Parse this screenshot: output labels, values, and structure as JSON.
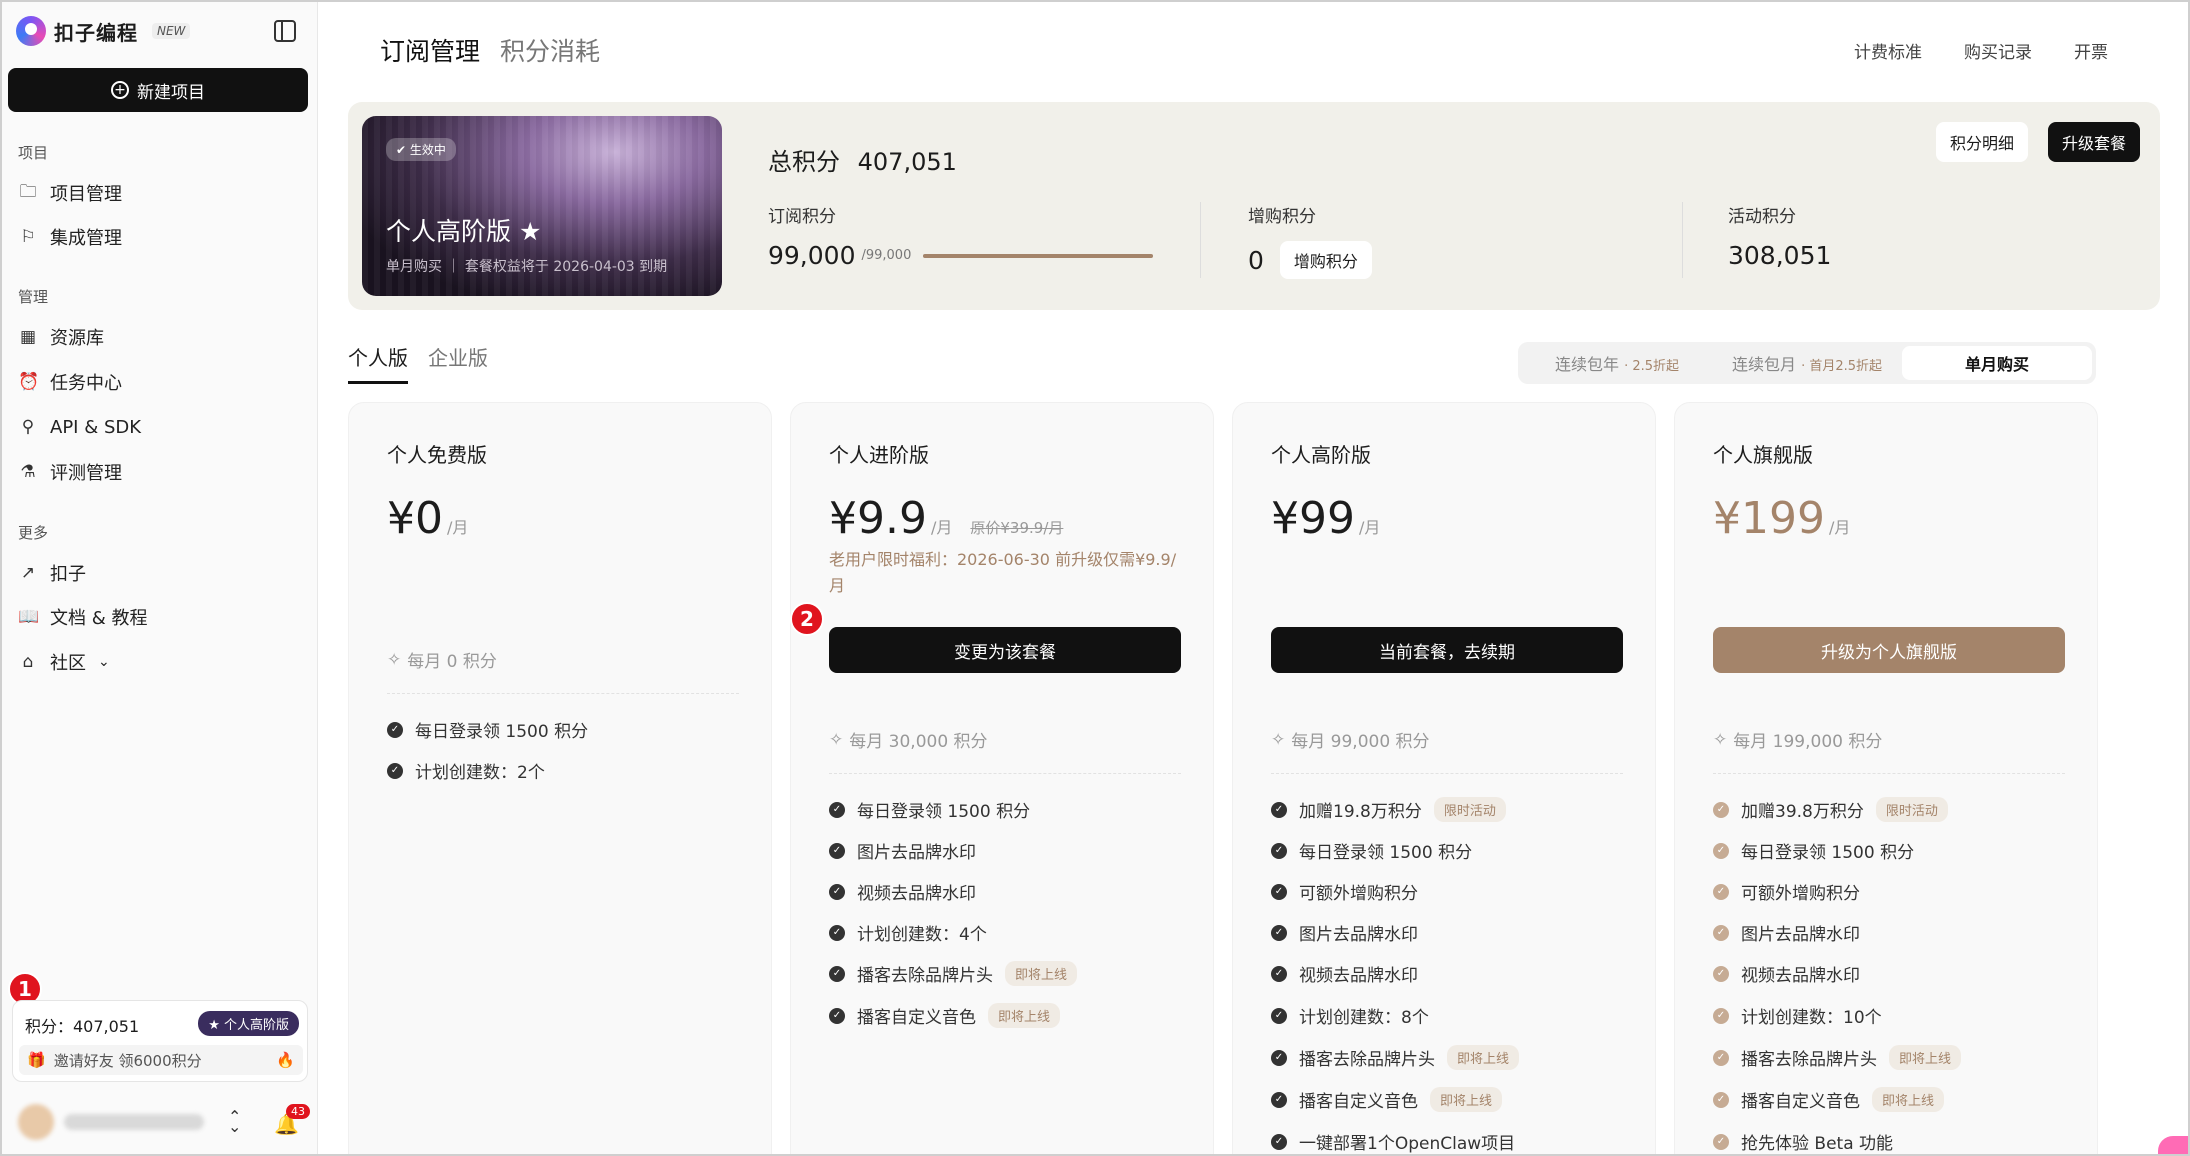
{
  "brand": {
    "name": "扣子编程",
    "tag": "NEW"
  },
  "sidebar": {
    "new_project": "新建项目",
    "sections": [
      {
        "label": "项目",
        "items": [
          {
            "label": "项目管理"
          },
          {
            "label": "集成管理"
          }
        ]
      },
      {
        "label": "管理",
        "items": [
          {
            "label": "资源库"
          },
          {
            "label": "任务中心"
          },
          {
            "label": "API & SDK"
          },
          {
            "label": "评测管理"
          }
        ]
      },
      {
        "label": "更多",
        "items": [
          {
            "label": "扣子"
          },
          {
            "label": "文档 & 教程"
          },
          {
            "label": "社区"
          }
        ]
      }
    ],
    "credits": {
      "label": "积分：407,051",
      "badge": "个人高阶版",
      "invite": "邀请好友 领6000积分"
    },
    "notifications": "43",
    "markers": [
      "1",
      "2"
    ]
  },
  "header": {
    "tabs": [
      "订阅管理",
      "积分消耗"
    ],
    "links": [
      "计费标准",
      "购买记录",
      "开票"
    ]
  },
  "summary": {
    "plan_status": "生效中",
    "plan_name": "个人高阶版 ★",
    "plan_sub": "单月购买 ｜ 套餐权益将于 2026-04-03 到期",
    "total_label": "总积分",
    "total_value": "407,051",
    "btn_detail": "积分明细",
    "btn_upgrade": "升级套餐",
    "sub_label": "订阅积分",
    "sub_value": "99,000",
    "sub_max": "/99,000",
    "sub_progress": 1.0,
    "add_label": "增购积分",
    "add_value": "0",
    "add_btn": "增购积分",
    "act_label": "活动积分",
    "act_value": "308,051"
  },
  "version_tabs": [
    "个人版",
    "企业版"
  ],
  "billing": [
    {
      "label": "连续包年",
      "discount": "· 2.5折起"
    },
    {
      "label": "连续包月",
      "discount": "· 首月2.5折起"
    },
    {
      "label": "单月购买",
      "discount": ""
    }
  ],
  "plans": [
    {
      "title": "个人免费版",
      "price": "¥0",
      "unit": "/月",
      "monthly": "每月 0 积分",
      "features": [
        {
          "text": "每日登录领 1500 积分"
        },
        {
          "text": "计划创建数：2个"
        }
      ]
    },
    {
      "title": "个人进阶版",
      "price": "¥9.9",
      "unit": "/月",
      "orig": "原价¥39.9/月",
      "promo": "老用户限时福利：2026-06-30 前升级仅需¥9.9/月",
      "button": "变更为该套餐",
      "monthly": "每月 30,000 积分",
      "features": [
        {
          "text": "每日登录领 1500 积分"
        },
        {
          "text": "图片去品牌水印"
        },
        {
          "text": "视频去品牌水印"
        },
        {
          "text": "计划创建数：4个"
        },
        {
          "text": "播客去除品牌片头",
          "tag": "即将上线"
        },
        {
          "text": "播客自定义音色",
          "tag": "即将上线"
        }
      ]
    },
    {
      "title": "个人高阶版",
      "price": "¥99",
      "unit": "/月",
      "button": "当前套餐，去续期",
      "monthly": "每月 99,000 积分",
      "features": [
        {
          "text": "加赠19.8万积分",
          "tag": "限时活动"
        },
        {
          "text": "每日登录领 1500 积分"
        },
        {
          "text": "可额外增购积分"
        },
        {
          "text": "图片去品牌水印"
        },
        {
          "text": "视频去品牌水印"
        },
        {
          "text": "计划创建数：8个"
        },
        {
          "text": "播客去除品牌片头",
          "tag": "即将上线"
        },
        {
          "text": "播客自定义音色",
          "tag": "即将上线"
        },
        {
          "text": "一键部署1个OpenClaw项目"
        }
      ]
    },
    {
      "title": "个人旗舰版",
      "price": "¥199",
      "unit": "/月",
      "button": "升级为个人旗舰版",
      "monthly": "每月 199,000 积分",
      "features": [
        {
          "text": "加赠39.8万积分",
          "tag": "限时活动"
        },
        {
          "text": "每日登录领 1500 积分"
        },
        {
          "text": "可额外增购积分"
        },
        {
          "text": "图片去品牌水印"
        },
        {
          "text": "视频去品牌水印"
        },
        {
          "text": "计划创建数：10个"
        },
        {
          "text": "播客去除品牌片头",
          "tag": "即将上线"
        },
        {
          "text": "播客自定义音色",
          "tag": "即将上线"
        },
        {
          "text": "抢先体验 Beta 功能"
        }
      ]
    }
  ],
  "colors": {
    "accent_brown": "#a4846a",
    "primary": "#111111",
    "badge_purple": "#3a2d5e",
    "marker_red": "#e0141e"
  }
}
